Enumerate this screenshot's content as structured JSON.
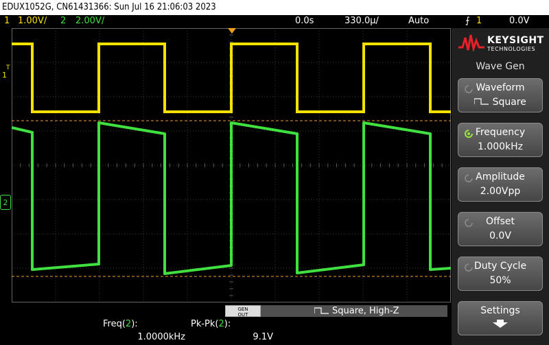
{
  "titlebar": {
    "text": "EDUX1052G, CN61431366: Sun Jul 16 21:06:03 2023"
  },
  "status": {
    "ch1_num": "1",
    "ch1_scale": "1.00V/",
    "ch2_num": "2",
    "ch2_scale": "2.00V/",
    "time_delay": "0.0s",
    "time_scale": "330.0µ/",
    "trigger_mode": "Auto",
    "trigger_num": "1",
    "trigger_level": "0.0V"
  },
  "markers": {
    "trigger_marker": "T",
    "ch1_marker": "1",
    "ch2_marker": "2"
  },
  "brand": {
    "name": "KEYSIGHT",
    "sub": "TECHNOLOGIES"
  },
  "menu": {
    "title": "Wave Gen",
    "buttons": [
      {
        "label": "Waveform",
        "value": "Square"
      },
      {
        "label": "Frequency",
        "value": "1.000kHz"
      },
      {
        "label": "Amplitude",
        "value": "2.00Vpp"
      },
      {
        "label": "Offset",
        "value": "0.0V"
      },
      {
        "label": "Duty Cycle",
        "value": "50%"
      },
      {
        "label": "Settings",
        "value": ""
      }
    ]
  },
  "wavegen_bar": {
    "gen_out": "GEN OUT",
    "status": "Square, High-Z"
  },
  "measurements": [
    {
      "label_prefix": "Freq(",
      "label_ch": "2",
      "label_suffix": "):",
      "value": "1.0000kHz"
    },
    {
      "label_prefix": "Pk-Pk(",
      "label_ch": "2",
      "label_suffix": "):",
      "value": "9.1V"
    }
  ],
  "traces": {
    "ch1": {
      "color": "#f5e100",
      "period_divisions": 3.0,
      "high_div": 0.5,
      "low_div": 2.95
    },
    "ch2": {
      "color": "#3fe03f"
    },
    "cursor_color": "#f39c1e"
  }
}
